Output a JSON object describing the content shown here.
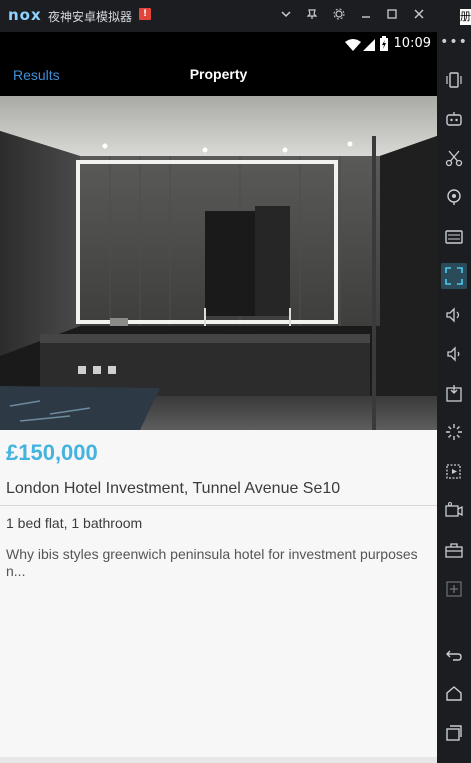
{
  "emulator": {
    "logo": "nox",
    "title": "夜神安卓模拟器",
    "warning_badge": "!",
    "edge_char": "册",
    "more": "•••",
    "buttons": [
      "chevron-down-icon",
      "pin-icon",
      "gear-icon",
      "minimize-icon",
      "maximize-icon",
      "close-icon"
    ],
    "side_tools": [
      "shake-icon",
      "robot-icon",
      "scissors-icon",
      "location-icon",
      "keyboard-icon",
      "fullscreen-icon",
      "volume-up-icon",
      "volume-down-icon",
      "apk-install-icon",
      "loading-icon",
      "screen-record-icon",
      "camera-icon",
      "toolbox-icon",
      "add-icon",
      "back-icon",
      "home-icon",
      "recent-apps-icon"
    ]
  },
  "status_bar": {
    "time": "10:09"
  },
  "action_bar": {
    "back_label": "Results",
    "title": "Property"
  },
  "listing": {
    "price": "£150,000",
    "address": "London Hotel Investment, Tunnel Avenue Se10",
    "rooms": "1 bed flat, 1 bathroom",
    "description": "Why ibis styles greenwich peninsula hotel for investment purposes n..."
  },
  "colors": {
    "accent_blue": "#3f8fd8",
    "price_blue": "#44b3e0",
    "chrome_dark": "#1b1d21",
    "active_tool": "#2a4b5a"
  }
}
